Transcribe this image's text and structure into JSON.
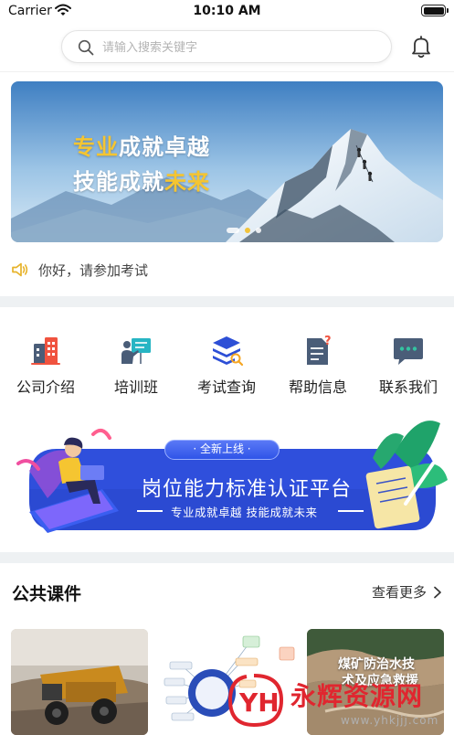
{
  "status_bar": {
    "carrier": "Carrier",
    "time": "10:10 AM"
  },
  "search": {
    "placeholder": "请输入搜索关键字",
    "value": ""
  },
  "banner": {
    "line1_a": "专业",
    "line1_b": "成就卓越",
    "line2_a": "技能成就",
    "line2_b": "未来",
    "active_slide": 2,
    "slide_count": 3
  },
  "notice": {
    "text": "你好，请参加考试",
    "icon": "speaker-icon"
  },
  "menu": {
    "items": [
      {
        "label": "公司介绍",
        "icon": "company-icon"
      },
      {
        "label": "培训班",
        "icon": "training-icon"
      },
      {
        "label": "考试查询",
        "icon": "exam-query-icon"
      },
      {
        "label": "帮助信息",
        "icon": "help-icon"
      },
      {
        "label": "联系我们",
        "icon": "contact-icon"
      }
    ]
  },
  "promo": {
    "tag": "· 全新上线 ·",
    "title": "岗位能力标准认证平台",
    "subtitle": "专业成就卓越   技能成就未来"
  },
  "courses": {
    "title": "公共课件",
    "more_label": "查看更多",
    "card3_caption_1": "煤矿防治水技",
    "card3_caption_2": "术及应急救援"
  },
  "watermark": {
    "text": "永辉资源网",
    "url": "www.yhkjjj.com",
    "logo_letters": "YH"
  },
  "colors": {
    "accent_blue": "#2f4fdc",
    "highlight_yellow": "#f5c531",
    "section_gap": "#eef1f3",
    "watermark_red": "#e0262f"
  }
}
